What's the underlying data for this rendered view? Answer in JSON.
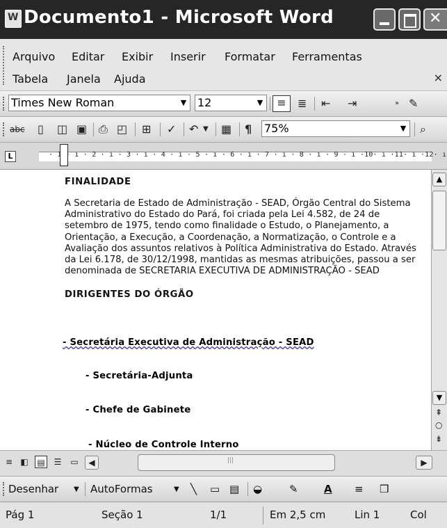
{
  "window": {
    "title": "Documento1 - Microsoft Word"
  },
  "menu": {
    "row1": [
      "Arquivo",
      "Editar",
      "Exibir",
      "Inserir",
      "Formatar",
      "Ferramentas"
    ],
    "row2": [
      "Tabela",
      "Janela",
      "Ajuda"
    ],
    "close": "×"
  },
  "formatting": {
    "font": "Times New Roman",
    "size": "12"
  },
  "standard": {
    "zoom": "75%",
    "pilcrow": "¶"
  },
  "ruler": {
    "marks": "· 1 · ı · 2 · ı · 3 · ı · 4 · ı · 5 · ı · 6 · ı · 7 · ı · 8 · ı · 9 · ı ·10· ı ·11· ı ·12· ı"
  },
  "document": {
    "heading1": "FINALIDADE",
    "paragraph1": "A Secretaria de Estado de Administração - SEAD, Órgão Central do Sistema Administrativo do Estado do Pará, foi criada pela Lei 4.582, de 24 de setembro de 1975, tendo como finalidade o Estudo, o Planejamento, a Orientação, a Execução, a Coordenação, a Normatização, o Controle e a Avaliação dos assuntos relativos à Política Administrativa do Estado. Através da Lei 6.178, de 30/12/1998, mantidas as mesmas atribuições, passou a ser denominada de SECRETARIA EXECUTIVA DE ADMINISTRAÇÃO - SEAD",
    "heading2": "DIRIGENTES DO ÓRGÃO",
    "item1": "- Secretária Executiva de Administração - SEAD",
    "item2": "- Secretária-Adjunta",
    "item3": "- Chefe de Gabinete",
    "item4": "- Núcleo de Controle Interno"
  },
  "drawing": {
    "draw": "Desenhar",
    "autoshapes": "AutoFormas"
  },
  "status": {
    "page": "Pág 1",
    "section": "Seção 1",
    "pages": "1/1",
    "position": "Em 2,5 cm",
    "line": "Lin 1",
    "column": "Col"
  }
}
